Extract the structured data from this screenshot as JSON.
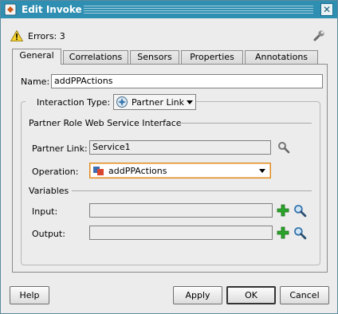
{
  "window": {
    "title": "Edit Invoke"
  },
  "errors": {
    "text": "Errors: 3"
  },
  "tabs": [
    {
      "label": "General"
    },
    {
      "label": "Correlations"
    },
    {
      "label": "Sensors"
    },
    {
      "label": "Properties"
    },
    {
      "label": "Annotations"
    }
  ],
  "general": {
    "name_label": "Name:",
    "name_value": "addPPActions",
    "interaction_type_label": "Interaction Type:",
    "interaction_type_value": "Partner Link",
    "partner_role_heading": "Partner Role Web Service Interface",
    "partner_link_label": "Partner Link:",
    "partner_link_value": "Service1",
    "operation_label": "Operation:",
    "operation_value": "addPPActions",
    "variables_heading": "Variables",
    "input_label": "Input:",
    "input_value": "",
    "output_label": "Output:",
    "output_value": ""
  },
  "buttons": {
    "help": "Help",
    "apply": "Apply",
    "ok": "OK",
    "cancel": "Cancel"
  },
  "colors": {
    "titlebar": "#2f8fb2",
    "operation_highlight": "#e08a1e",
    "add_green": "#2aa52a"
  }
}
